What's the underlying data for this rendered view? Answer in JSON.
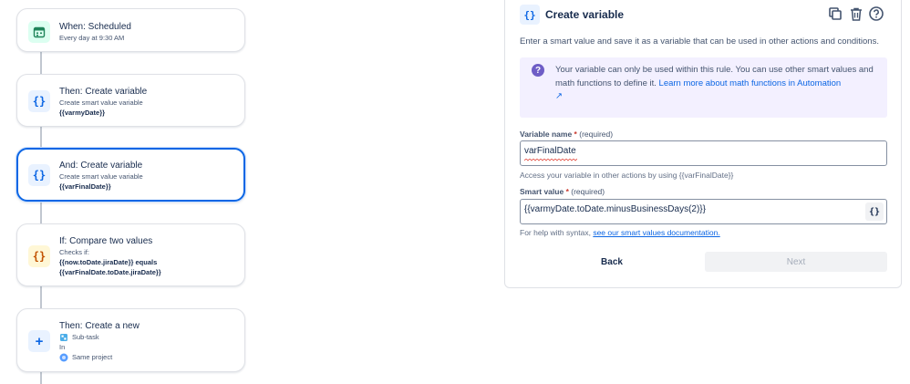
{
  "flow": {
    "items": [
      {
        "icon": "calendar-icon",
        "title": "When: Scheduled",
        "lines": [
          {
            "text": "Every day at 9:30 AM",
            "bold": false
          }
        ]
      },
      {
        "icon": "braces-icon",
        "icon_text": "{}",
        "title": "Then: Create variable",
        "lines": [
          {
            "text": "Create smart value variable",
            "bold": false
          },
          {
            "text": "{{varmyDate}}",
            "bold": true
          }
        ]
      },
      {
        "icon": "braces-icon",
        "icon_text": "{}",
        "title": "And: Create variable",
        "lines": [
          {
            "text": "Create smart value variable",
            "bold": false
          },
          {
            "text": "{{varFinalDate}}",
            "bold": true
          }
        ]
      },
      {
        "icon": "braces-icon",
        "icon_text": "{}",
        "title": "If: Compare two values",
        "lines": [
          {
            "text": "Checks if:",
            "bold": false
          },
          {
            "text": "{{now.toDate.jiraDate}} equals",
            "bold": true
          },
          {
            "text": "{{varFinalDate.toDate.jiraDate}}",
            "bold": true
          }
        ]
      },
      {
        "icon": "plus-icon",
        "icon_text": "+",
        "title": "Then: Create a new",
        "lines": [
          {
            "text": "Sub-task",
            "bold": false
          },
          {
            "text": "In",
            "bold": false
          },
          {
            "text": "Same project",
            "bold": false
          }
        ]
      }
    ]
  },
  "panel": {
    "icon_text": "{}",
    "title": "Create variable",
    "description": "Enter a smart value and save it as a variable that can be used in other actions and conditions.",
    "info": {
      "text": "Your variable can only be used within this rule. You can use other smart values and math functions to define it.",
      "link": "Learn more about math functions in Automation",
      "link_icon": "↗"
    },
    "variable_name": {
      "label": "Variable name",
      "star": "*",
      "required": "(required)",
      "value": "varFinalDate",
      "helper": "Access your variable in other actions by using {{varFinalDate}}"
    },
    "smart_value": {
      "label": "Smart value",
      "star": "*",
      "required": "(required)",
      "value": "{{varmyDate.toDate.minusBusinessDays(2)}}",
      "button": "{}",
      "helper": "For help with syntax,",
      "helper_link": "see our smart values documentation."
    },
    "buttons": {
      "back": "Back",
      "next": "Next"
    },
    "colors": {
      "accent": "#0c66e4",
      "info_bg": "#f3f0ff",
      "info_icon": "#6e5dc6"
    }
  }
}
